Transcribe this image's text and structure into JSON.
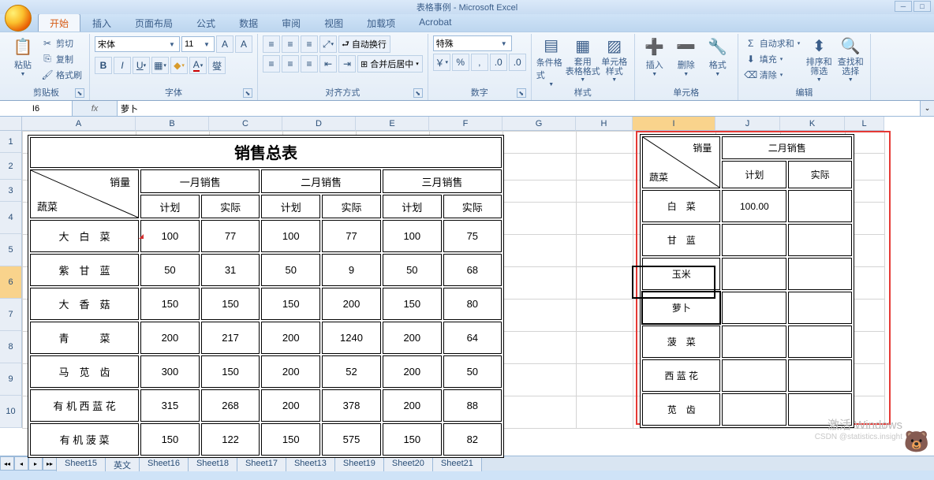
{
  "window": {
    "title": "表格事例 - Microsoft Excel"
  },
  "tabs": [
    "开始",
    "插入",
    "页面布局",
    "公式",
    "数据",
    "审阅",
    "视图",
    "加载项",
    "Acrobat"
  ],
  "ribbon": {
    "clipboard": {
      "label": "剪贴板",
      "paste": "粘贴",
      "cut": "剪切",
      "copy": "复制",
      "format_painter": "格式刷"
    },
    "font": {
      "label": "字体",
      "name": "宋体",
      "size": "11"
    },
    "align": {
      "label": "对齐方式",
      "wrap": "自动换行",
      "merge": "合并后居中"
    },
    "number": {
      "label": "数字",
      "format": "特殊"
    },
    "styles": {
      "label": "样式",
      "cond": "条件格式",
      "table": "套用\n表格格式",
      "cell": "单元格\n样式"
    },
    "cells": {
      "label": "单元格",
      "insert": "插入",
      "delete": "删除",
      "format": "格式"
    },
    "editing": {
      "label": "编辑",
      "sum": "自动求和",
      "fill": "填充",
      "clear": "清除",
      "sort": "排序和\n筛选",
      "find": "查找和\n选择"
    }
  },
  "namebox": "I6",
  "formula": "萝卜",
  "columns": [
    {
      "l": "A",
      "w": 144
    },
    {
      "l": "B",
      "w": 93
    },
    {
      "l": "C",
      "w": 93
    },
    {
      "l": "D",
      "w": 93
    },
    {
      "l": "E",
      "w": 93
    },
    {
      "l": "F",
      "w": 93
    },
    {
      "l": "G",
      "w": 93
    },
    {
      "l": "H",
      "w": 72
    },
    {
      "l": "I",
      "w": 105
    },
    {
      "l": "J",
      "w": 82
    },
    {
      "l": "K",
      "w": 82
    },
    {
      "l": "L",
      "w": 50
    }
  ],
  "rows": [
    {
      "n": 1,
      "h": 28
    },
    {
      "n": 2,
      "h": 34
    },
    {
      "n": 3,
      "h": 28
    },
    {
      "n": 4,
      "h": 41
    },
    {
      "n": 5,
      "h": 41
    },
    {
      "n": 6,
      "h": 41
    },
    {
      "n": 7,
      "h": 41
    },
    {
      "n": 8,
      "h": 41
    },
    {
      "n": 9,
      "h": 41
    },
    {
      "n": 10,
      "h": 41
    }
  ],
  "sel": {
    "col": 8,
    "row": 5
  },
  "main_table": {
    "title": "销售总表",
    "corner_top": "销量",
    "corner_bottom": "蔬菜",
    "months": [
      "一月销售",
      "二月销售",
      "三月销售"
    ],
    "sub": [
      "计划",
      "实际"
    ],
    "rows": [
      {
        "veg": "大　白　菜",
        "v": [
          100,
          77,
          100,
          77,
          100,
          75
        ]
      },
      {
        "veg": "紫　甘　蓝",
        "v": [
          50,
          31,
          50,
          9,
          50,
          68
        ]
      },
      {
        "veg": "大　香　菇",
        "v": [
          150,
          150,
          150,
          200,
          150,
          80
        ]
      },
      {
        "veg": "青　　　菜",
        "v": [
          200,
          217,
          200,
          1240,
          200,
          64
        ]
      },
      {
        "veg": "马　苋　齿",
        "v": [
          300,
          150,
          200,
          52,
          200,
          50
        ]
      },
      {
        "veg": "有 机 西 蓝 花",
        "v": [
          315,
          268,
          200,
          378,
          200,
          88
        ]
      },
      {
        "veg": "有 机 菠 菜",
        "v": [
          150,
          122,
          150,
          575,
          150,
          82
        ]
      }
    ]
  },
  "side_table": {
    "corner_top": "销量",
    "corner_bottom": "蔬菜",
    "month": "二月销售",
    "sub": [
      "计划",
      "实际"
    ],
    "rows": [
      {
        "veg": "白　菜",
        "plan": "100.00",
        "act": ""
      },
      {
        "veg": "甘　蓝",
        "plan": "",
        "act": ""
      },
      {
        "veg": "玉米",
        "plan": "",
        "act": ""
      },
      {
        "veg": "萝卜",
        "plan": "",
        "act": ""
      },
      {
        "veg": "菠　菜",
        "plan": "",
        "act": ""
      },
      {
        "veg": "西 蓝 花",
        "plan": "",
        "act": ""
      },
      {
        "veg": "苋　齿",
        "plan": "",
        "act": ""
      }
    ]
  },
  "sheet_tabs": [
    "Sheet15",
    "英文",
    "Sheet16",
    "Sheet18",
    "Sheet17",
    "Sheet13",
    "Sheet19",
    "Sheet20",
    "Sheet21"
  ],
  "watermark": {
    "l1": "激活 Windows",
    "l2": "CSDN @statistics.insight"
  }
}
